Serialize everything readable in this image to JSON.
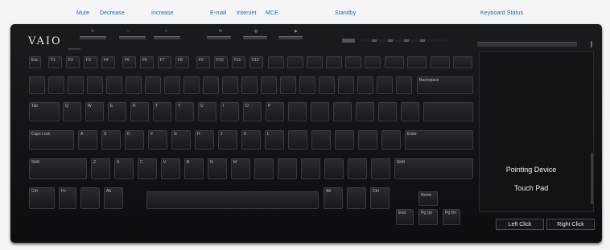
{
  "callouts": {
    "mute": "Mute",
    "decrease": "Decrease",
    "increase": "Increase",
    "email": "E-mail",
    "internet": "Internet",
    "mce": "MCE",
    "standby": "Standby",
    "keyboard_status": "Keyboard Status"
  },
  "brand": {
    "logo": "VAIO"
  },
  "touchpad": {
    "label_line1": "Pointing Device",
    "label_line2": "Touch Pad",
    "left_click": "Left Click",
    "right_click": "Right Click"
  },
  "keys": {
    "esc": "Esc",
    "f1": "F1",
    "f2": "F2",
    "f3": "F3",
    "f4": "F4",
    "f5": "F5",
    "f6": "F6",
    "f7": "F7",
    "f8": "F8",
    "f9": "F9",
    "f10": "F10",
    "f11": "F11",
    "f12": "F12",
    "q": "Q",
    "w": "W",
    "e": "E",
    "r": "R",
    "t": "T",
    "y": "Y",
    "u": "U",
    "i": "I",
    "o": "O",
    "p": "P",
    "a": "A",
    "s": "S",
    "d": "D",
    "f": "F",
    "g": "G",
    "h": "H",
    "j": "J",
    "k": "K",
    "l": "L",
    "z": "Z",
    "x": "X",
    "c": "C",
    "v": "V",
    "b": "B",
    "n": "N",
    "m": "M",
    "tab": "Tab",
    "caps": "Caps Lock",
    "shift": "Shift",
    "ctrl": "Ctrl",
    "fn": "Fn",
    "alt": "Alt",
    "backspace": "Backspace",
    "enter": "Enter",
    "home": "Home",
    "end": "End",
    "pgup": "Pg Up",
    "pgdn": "Pg Dn"
  }
}
